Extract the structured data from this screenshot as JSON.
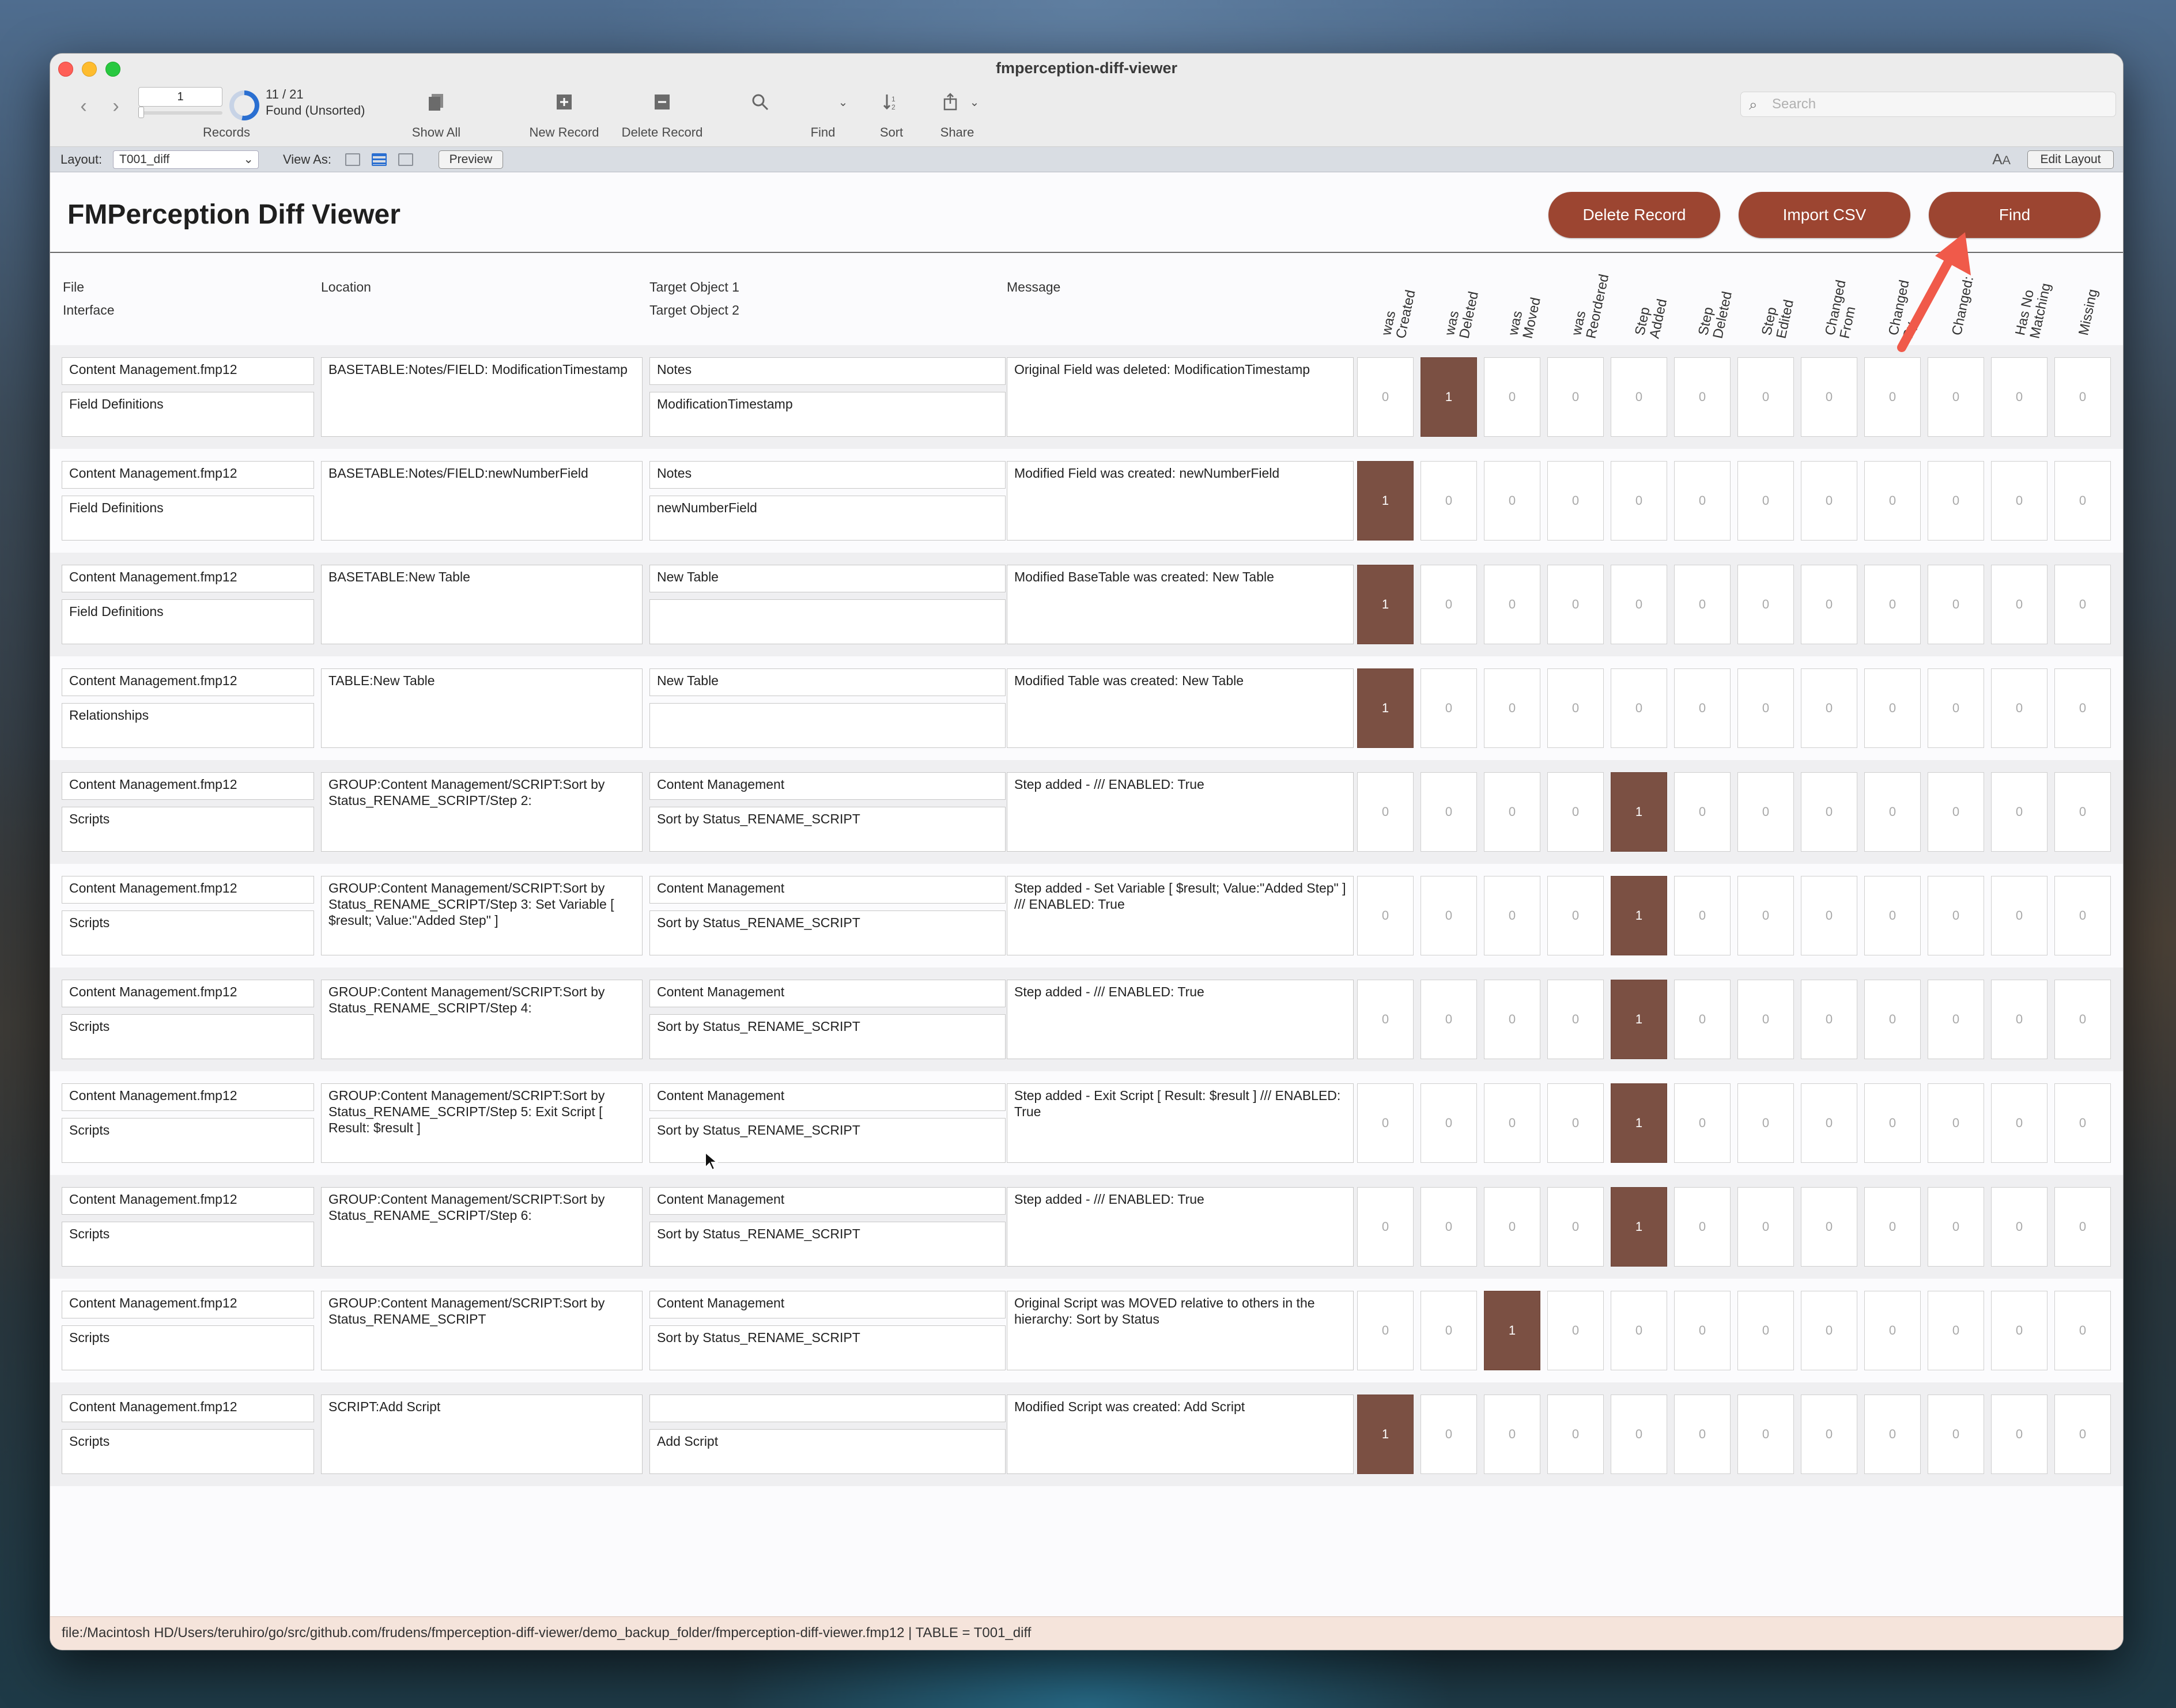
{
  "window": {
    "title": "fmperception-diff-viewer"
  },
  "toolbar": {
    "record_input": "1",
    "found_count": "11 / 21",
    "found_state": "Found (Unsorted)",
    "records_label": "Records",
    "show_all": "Show All",
    "new_record": "New Record",
    "delete_record": "Delete Record",
    "find": "Find",
    "sort": "Sort",
    "share": "Share",
    "search_placeholder": "Search"
  },
  "layoutbar": {
    "layout_label": "Layout:",
    "layout_value": "T001_diff",
    "view_as_label": "View As:",
    "preview": "Preview",
    "edit_layout": "Edit Layout"
  },
  "header": {
    "title": "FMPerception Diff Viewer",
    "delete_button": "Delete Record",
    "import_button": "Import CSV",
    "find_button": "Find",
    "button_color": "#9c4531"
  },
  "columns": {
    "file": "File",
    "interface": "Interface",
    "location": "Location",
    "target1": "Target Object 1",
    "target2": "Target Object 2",
    "message": "Message",
    "flags": [
      {
        "l1": "was",
        "l2": "Created"
      },
      {
        "l1": "was",
        "l2": "Deleted"
      },
      {
        "l1": "was",
        "l2": "Moved"
      },
      {
        "l1": "was",
        "l2": "Reordered"
      },
      {
        "l1": "Step",
        "l2": "Added"
      },
      {
        "l1": "Step",
        "l2": "Deleted"
      },
      {
        "l1": "Step",
        "l2": "Edited"
      },
      {
        "l1": "Changed",
        "l2": "From"
      },
      {
        "l1": "Changed",
        "l2": "By"
      },
      {
        "l1": "Changed:",
        "l2": ""
      },
      {
        "l1": "Has No",
        "l2": "Matching"
      },
      {
        "l1": "Missing",
        "l2": ""
      }
    ]
  },
  "flag_on_color": "#7b5043",
  "rows": [
    {
      "file": "Content Management.fmp12",
      "interface": "Field Definitions",
      "location": "BASETABLE:Notes/FIELD: ModificationTimestamp",
      "target1": "Notes",
      "target2": "ModificationTimestamp",
      "message": "Original Field was deleted: ModificationTimestamp",
      "flags": [
        "0",
        "1",
        "0",
        "0",
        "0",
        "0",
        "0",
        "0",
        "0",
        "0",
        "0",
        "0"
      ]
    },
    {
      "file": "Content Management.fmp12",
      "interface": "Field Definitions",
      "location": "BASETABLE:Notes/FIELD:newNumberField",
      "target1": "Notes",
      "target2": "newNumberField",
      "message": "Modified Field was created: newNumberField",
      "flags": [
        "1",
        "0",
        "0",
        "0",
        "0",
        "0",
        "0",
        "0",
        "0",
        "0",
        "0",
        "0"
      ]
    },
    {
      "file": "Content Management.fmp12",
      "interface": "Field Definitions",
      "location": "BASETABLE:New Table",
      "target1": "New Table",
      "target2": "",
      "message": "Modified BaseTable was created: New Table",
      "flags": [
        "1",
        "0",
        "0",
        "0",
        "0",
        "0",
        "0",
        "0",
        "0",
        "0",
        "0",
        "0"
      ]
    },
    {
      "file": "Content Management.fmp12",
      "interface": "Relationships",
      "location": "TABLE:New Table",
      "target1": "New Table",
      "target2": "",
      "message": "Modified Table was created: New Table",
      "flags": [
        "1",
        "0",
        "0",
        "0",
        "0",
        "0",
        "0",
        "0",
        "0",
        "0",
        "0",
        "0"
      ]
    },
    {
      "file": "Content Management.fmp12",
      "interface": "Scripts",
      "location": "GROUP:Content Management/SCRIPT:Sort by Status_RENAME_SCRIPT/Step 2:",
      "target1": "Content Management",
      "target2": "Sort by Status_RENAME_SCRIPT",
      "message": "Step added -  /// ENABLED: True",
      "flags": [
        "0",
        "0",
        "0",
        "0",
        "1",
        "0",
        "0",
        "0",
        "0",
        "0",
        "0",
        "0"
      ]
    },
    {
      "file": "Content Management.fmp12",
      "interface": "Scripts",
      "location": "GROUP:Content Management/SCRIPT:Sort by Status_RENAME_SCRIPT/Step 3: Set Variable [ $result; Value:\"Added Step\" ]",
      "target1": "Content Management",
      "target2": "Sort by Status_RENAME_SCRIPT",
      "message": "Step added - Set Variable [ $result; Value:\"Added Step\" ] /// ENABLED: True",
      "flags": [
        "0",
        "0",
        "0",
        "0",
        "1",
        "0",
        "0",
        "0",
        "0",
        "0",
        "0",
        "0"
      ]
    },
    {
      "file": "Content Management.fmp12",
      "interface": "Scripts",
      "location": "GROUP:Content Management/SCRIPT:Sort by Status_RENAME_SCRIPT/Step 4:",
      "target1": "Content Management",
      "target2": "Sort by Status_RENAME_SCRIPT",
      "message": "Step added -  /// ENABLED: True",
      "flags": [
        "0",
        "0",
        "0",
        "0",
        "1",
        "0",
        "0",
        "0",
        "0",
        "0",
        "0",
        "0"
      ]
    },
    {
      "file": "Content Management.fmp12",
      "interface": "Scripts",
      "location": "GROUP:Content Management/SCRIPT:Sort by Status_RENAME_SCRIPT/Step 5: Exit Script [ Result: $result ]",
      "target1": "Content Management",
      "target2": "Sort by Status_RENAME_SCRIPT",
      "message": "Step added - Exit Script [ Result: $result ] /// ENABLED: True",
      "flags": [
        "0",
        "0",
        "0",
        "0",
        "1",
        "0",
        "0",
        "0",
        "0",
        "0",
        "0",
        "0"
      ]
    },
    {
      "file": "Content Management.fmp12",
      "interface": "Scripts",
      "location": "GROUP:Content Management/SCRIPT:Sort by Status_RENAME_SCRIPT/Step 6:",
      "target1": "Content Management",
      "target2": "Sort by Status_RENAME_SCRIPT",
      "message": "Step added -  /// ENABLED: True",
      "flags": [
        "0",
        "0",
        "0",
        "0",
        "1",
        "0",
        "0",
        "0",
        "0",
        "0",
        "0",
        "0"
      ]
    },
    {
      "file": "Content Management.fmp12",
      "interface": "Scripts",
      "location": "GROUP:Content Management/SCRIPT:Sort by Status_RENAME_SCRIPT",
      "target1": "Content Management",
      "target2": "Sort by Status_RENAME_SCRIPT",
      "message": "Original Script was MOVED relative to others in the hierarchy: Sort by Status",
      "flags": [
        "0",
        "0",
        "1",
        "0",
        "0",
        "0",
        "0",
        "0",
        "0",
        "0",
        "0",
        "0"
      ]
    },
    {
      "file": "Content Management.fmp12",
      "interface": "Scripts",
      "location": "SCRIPT:Add Script",
      "target1": "",
      "target2": "Add Script",
      "message": "Modified Script was created: Add Script",
      "flags": [
        "1",
        "0",
        "0",
        "0",
        "0",
        "0",
        "0",
        "0",
        "0",
        "0",
        "0",
        "0"
      ]
    }
  ],
  "statusbar": {
    "text": "file:/Macintosh HD/Users/teruhiro/go/src/github.com/frudens/fmperception-diff-viewer/demo_backup_folder/fmperception-diff-viewer.fmp12 | TABLE = T001_diff"
  }
}
